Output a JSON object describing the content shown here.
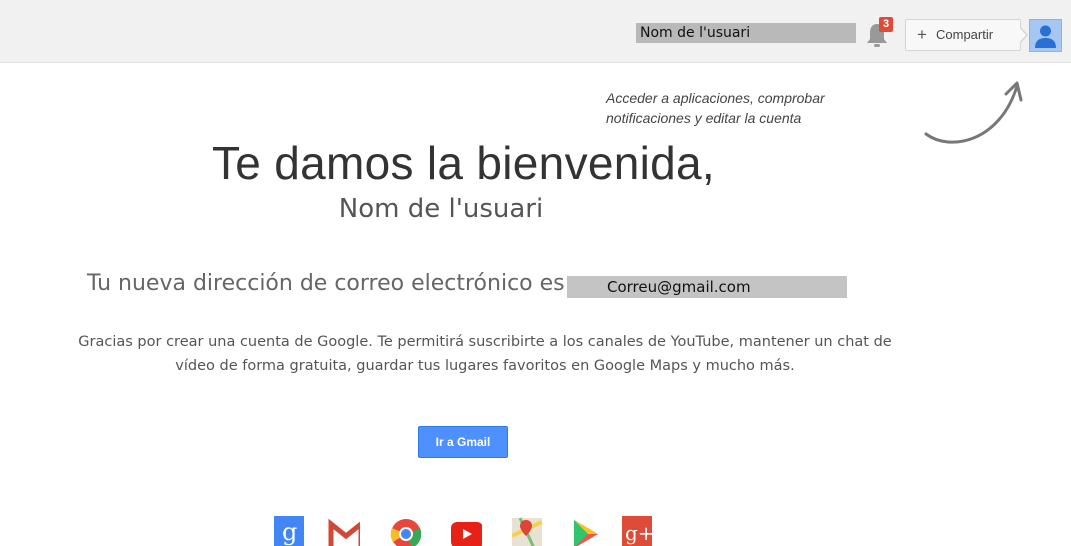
{
  "header": {
    "username": "Nom de l'usuari",
    "notification_count": "3",
    "share_label": "Compartir",
    "share_plus": "+"
  },
  "hint": "Acceder a aplicaciones, comprobar notificaciones y editar la cuenta",
  "welcome": {
    "title": "Te damos la bienvenida,",
    "name": "Nom de l'usuari"
  },
  "email": {
    "prefix": "Tu nueva dirección de correo electrónico es",
    "address": "Correu@gmail.com"
  },
  "description": "Gracias por crear una cuenta de Google. Te permitirá suscribirte a los canales de YouTube, mantener un chat de vídeo de forma gratuita, guardar tus lugares favoritos en Google Maps y mucho más.",
  "cta_label": "Ir a Gmail",
  "apps": [
    {
      "icon": "google-search-icon",
      "glyph": "g"
    },
    {
      "icon": "gmail-icon"
    },
    {
      "icon": "chrome-icon"
    },
    {
      "icon": "youtube-icon"
    },
    {
      "icon": "maps-icon"
    },
    {
      "icon": "play-store-icon"
    },
    {
      "icon": "google-plus-icon",
      "glyph": "g+"
    }
  ],
  "colors": {
    "accent_blue": "#4d90fe",
    "badge_red": "#dd4b39",
    "google_blue": "#4285f4",
    "gmail_red": "#d14836",
    "youtube_red": "#e62117",
    "gplus_red": "#dd4b39"
  }
}
